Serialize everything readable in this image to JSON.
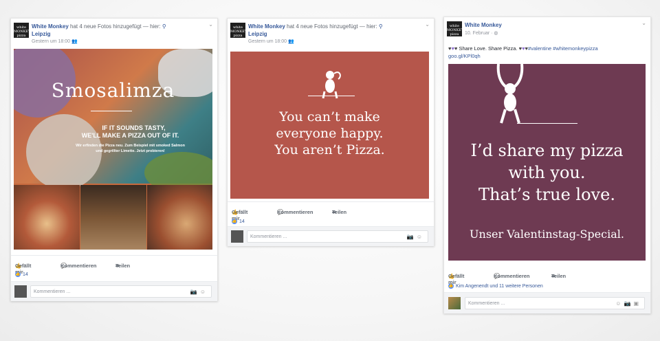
{
  "posts": [
    {
      "page_name": "White Monkey",
      "action_text": " hat 4 neue Fotos hinzugefügt — hier: ",
      "location": "Leipzig",
      "time": "Gestern um 18:00",
      "image": {
        "headline": "Smosalimza",
        "tagline_1": "IF IT SOUNDS TASTY,",
        "tagline_2": "WE'LL MAKE A PIZZA OUT OF IT.",
        "body_1": "Wir erfinden die Pizza neu. Zum Beispiel mit smoked Salmon",
        "body_2": "und gegrillter Limette. Jetzt probieren!"
      },
      "like_label": "Gefällt mir",
      "comment_label": "Kommentieren",
      "share_label": "Teilen",
      "like_count": "14",
      "comment_placeholder": "Kommentieren ..."
    },
    {
      "page_name": "White Monkey",
      "action_text": " hat 4 neue Fotos hinzugefügt — hier: ",
      "location": "Leipzig",
      "time": "Gestern um 18:00",
      "image": {
        "line_1": "You can’t make",
        "line_2": "everyone happy.",
        "line_3": "You aren’t Pizza.",
        "background": "#b5564b"
      },
      "like_label": "Gefällt mir",
      "comment_label": "Kommentieren",
      "share_label": "Teilen",
      "like_count": "14",
      "comment_placeholder": "Kommentieren ..."
    },
    {
      "page_name": "White Monkey",
      "time": "10. Februar",
      "caption": "Share Love. Share Pizza.",
      "hashtags": "#valentine #whitemonkeypizza",
      "link": "goo.gl/KPl0qh",
      "image": {
        "line_1": "I’d share my pizza",
        "line_2": "with you.",
        "line_3": "That’s true love.",
        "line_4": "Unser Valentinstag-Special.",
        "background": "#6e3a52"
      },
      "like_label": "Gefällt mir",
      "comment_label": "Kommentieren",
      "share_label": "Teilen",
      "likers": "Kim Angenendt und 11 weitere Personen",
      "comment_placeholder": "Kommentieren ..."
    }
  ],
  "colors": {
    "link_blue": "#365899",
    "like_blue": "#5890ff"
  }
}
